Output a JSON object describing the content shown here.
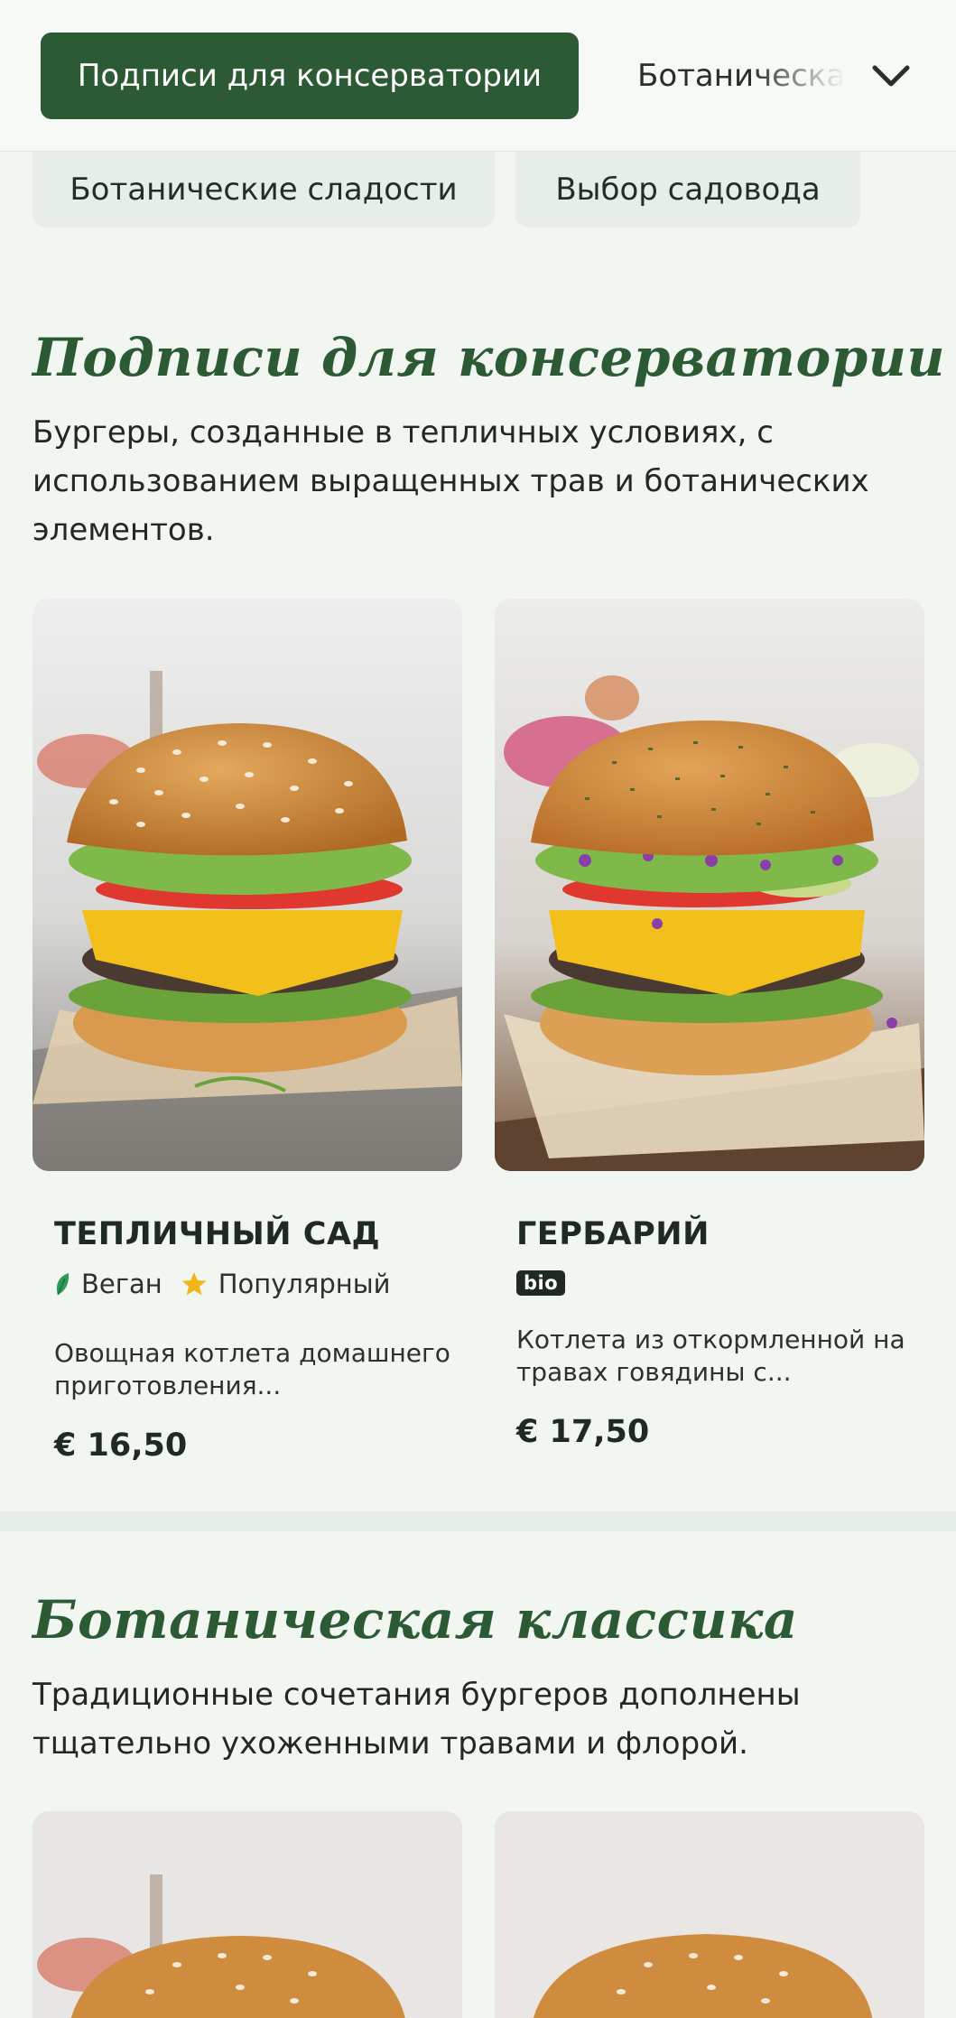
{
  "category_nav": {
    "active_label": "Подписи для консерватории",
    "next_label": "Ботаническая классика",
    "row2": [
      {
        "label": "Ботанические сладости"
      },
      {
        "label": "Выбор садовода"
      }
    ]
  },
  "sections": [
    {
      "title": "Подписи для консерватории",
      "description": "Бургеры, созданные в тепличных условиях, с использованием выращенных трав и ботанических элементов.",
      "products": [
        {
          "name": "ТЕПЛИЧНЫЙ САД",
          "tags": [
            {
              "icon": "leaf-icon",
              "label": "Веган",
              "color": "#2f9a55"
            },
            {
              "icon": "star-icon",
              "label": "Популярный",
              "color": "#f2b51c"
            }
          ],
          "description": "Овощная котлета домашнего приготовления...",
          "price": "€ 16,50"
        },
        {
          "name": "ГЕРБАРИЙ",
          "badge": "bio",
          "description": "Котлета из откормленной на травах говядины с...",
          "price": "€ 17,50"
        }
      ]
    },
    {
      "title": "Ботаническая классика",
      "description": "Традиционные сочетания бургеров дополнены тщательно ухоженными травами и флорой."
    }
  ],
  "colors": {
    "brand_green": "#2b5a34",
    "background": "#f1f6f1",
    "chip_soft": "#e6eee7"
  }
}
